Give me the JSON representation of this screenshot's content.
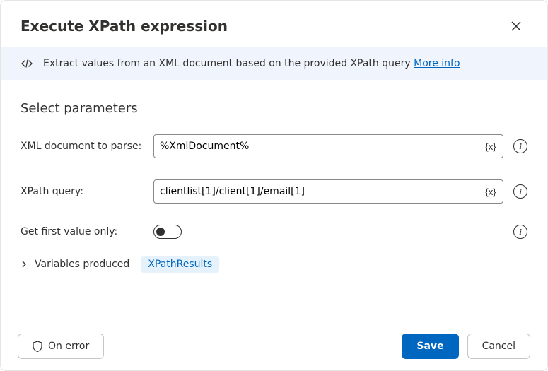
{
  "header": {
    "title": "Execute XPath expression"
  },
  "info": {
    "text": "Extract values from an XML document based on the provided XPath query ",
    "link": "More info"
  },
  "section": {
    "title": "Select parameters"
  },
  "params": {
    "xml_doc": {
      "label": "XML document to parse:",
      "value": "%XmlDocument%"
    },
    "xpath": {
      "label": "XPath query:",
      "value": "clientlist[1]/client[1]/email[1]"
    },
    "first_only": {
      "label": "Get first value only:",
      "value": false
    }
  },
  "variables": {
    "label": "Variables produced",
    "chip": "XPathResults"
  },
  "buttons": {
    "on_error": "On error",
    "save": "Save",
    "cancel": "Cancel"
  },
  "glyphs": {
    "var_token": "{x}"
  }
}
